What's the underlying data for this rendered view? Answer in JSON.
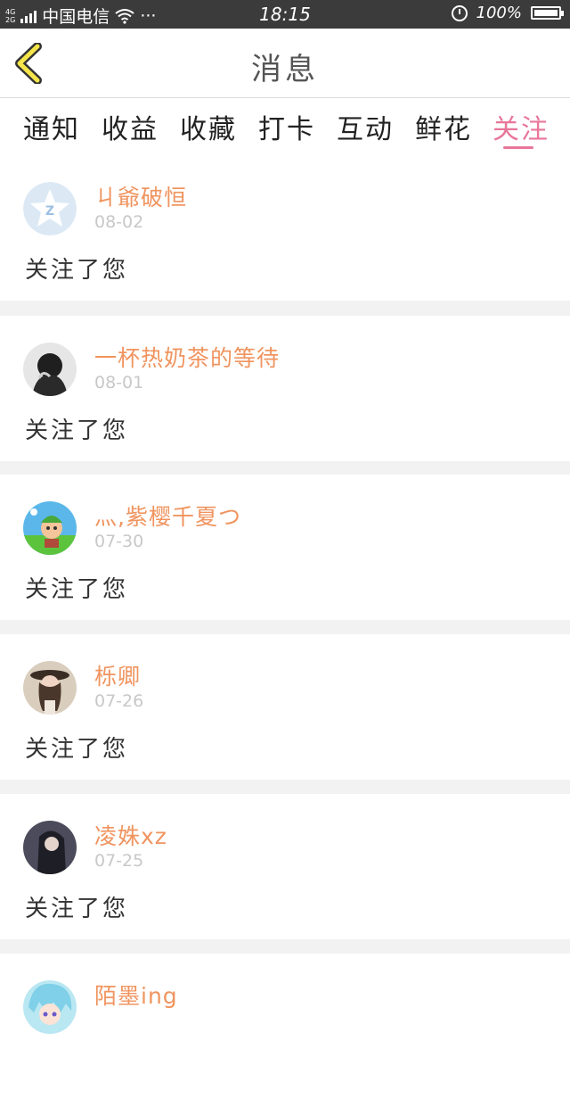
{
  "status_bar": {
    "network_top": "4G",
    "network_bottom": "2G",
    "carrier": "中国电信",
    "more": "···",
    "time": "18:15",
    "battery": "100%"
  },
  "nav": {
    "title": "消息"
  },
  "tabs": [
    {
      "label": "通知"
    },
    {
      "label": "收益"
    },
    {
      "label": "收藏"
    },
    {
      "label": "打卡"
    },
    {
      "label": "互动"
    },
    {
      "label": "鲜花"
    },
    {
      "label": "关注"
    }
  ],
  "active_tab": "关注",
  "colors": {
    "accent": "#e8769a",
    "username": "#f0945f",
    "date": "#c8c8c8",
    "status_bar": "#3b3b3b",
    "back_arrow_fill": "#f5e54a"
  },
  "messages": [
    {
      "name": "ㄐ爺破恒",
      "date": "08-02",
      "action": "关注了您",
      "avatar": "default-avatar-icon"
    },
    {
      "name": "一杯热奶茶的等待",
      "date": "08-01",
      "action": "关注了您",
      "avatar": "user-photo"
    },
    {
      "name": "灬,紫樱千夏つ",
      "date": "07-30",
      "action": "关注了您",
      "avatar": "cartoon-avatar"
    },
    {
      "name": "栎卿",
      "date": "07-26",
      "action": "关注了您",
      "avatar": "user-photo"
    },
    {
      "name": "凌姝xz",
      "date": "07-25",
      "action": "关注了您",
      "avatar": "user-photo"
    },
    {
      "name": "陌墨ing",
      "date": "",
      "action": "",
      "avatar": "anime-avatar"
    }
  ]
}
